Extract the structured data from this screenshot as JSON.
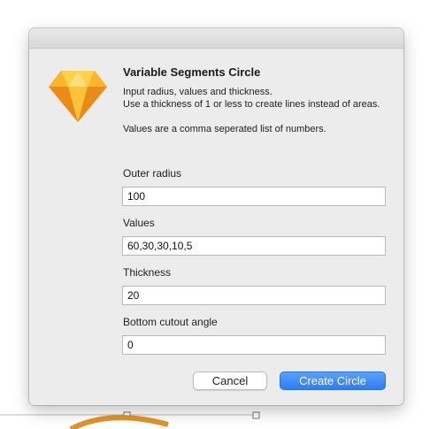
{
  "dialog": {
    "title": "Variable Segments Circle",
    "description": [
      "Input radius, values and thickness.",
      "Use a thickness of 1 or less to create lines instead of areas.",
      "Values are a comma seperated list of numbers."
    ],
    "fields": [
      {
        "label": "Outer radius",
        "value": "100"
      },
      {
        "label": "Values",
        "value": "60,30,30,10,5"
      },
      {
        "label": "Thickness",
        "value": "20"
      },
      {
        "label": "Bottom cutout angle",
        "value": "0"
      }
    ],
    "buttons": {
      "cancel": "Cancel",
      "create": "Create Circle"
    },
    "icon": "sketch-diamond-icon"
  },
  "colors": {
    "accent": "#2e7cf6",
    "arc": "#e2922c",
    "icon_orange": "#f7a51c"
  }
}
